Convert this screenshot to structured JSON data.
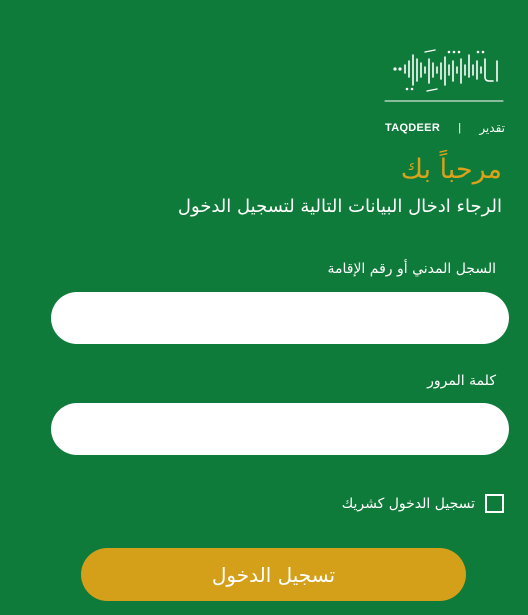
{
  "brand": {
    "logo_latin": "TAQDEER",
    "logo_separator": "|",
    "logo_arabic": "تقدير"
  },
  "welcome": {
    "title": "مرحباً بك",
    "subtitle": "الرجاء ادخال البيانات التالية لتسجيل الدخول"
  },
  "form": {
    "id_label": "السجل المدني أو رقم الإقامة",
    "id_value": "",
    "password_label": "كلمة المرور",
    "password_value": "",
    "partner_login_label": "تسجيل الدخول كشريك",
    "partner_login_checked": false,
    "submit_label": "تسجيل الدخول"
  },
  "colors": {
    "background": "#0f7b3a",
    "accent_gold": "#d4a01a",
    "welcome_gold": "#d9a21b",
    "text": "#ffffff",
    "input_background": "#ffffff"
  }
}
